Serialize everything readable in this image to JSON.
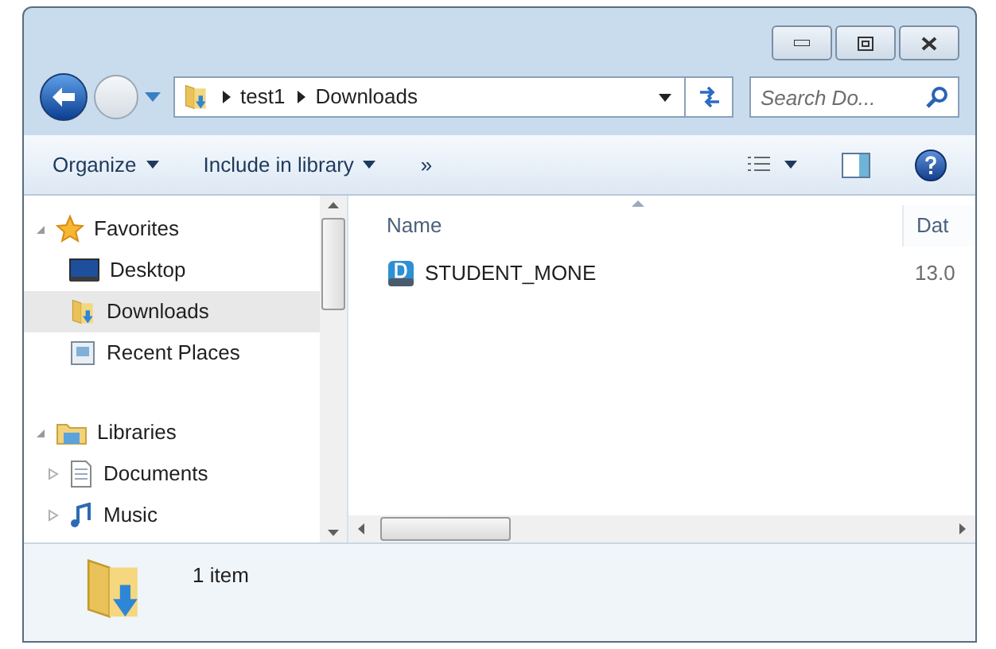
{
  "address": {
    "segments": [
      "test1",
      "Downloads"
    ]
  },
  "search": {
    "placeholder": "Search Do..."
  },
  "toolbar": {
    "buttons": [
      {
        "label": "Organize",
        "kind": "menu"
      },
      {
        "label": "Include in library",
        "kind": "menu"
      },
      {
        "label": "»",
        "kind": "more"
      }
    ]
  },
  "sidebar": {
    "groups": [
      {
        "label": "Favorites",
        "kind": "star",
        "expanded": true,
        "children": [
          {
            "label": "Desktop",
            "kind": "desktop",
            "selected": false
          },
          {
            "label": "Downloads",
            "kind": "downloads",
            "selected": true
          },
          {
            "label": "Recent Places",
            "kind": "recent",
            "selected": false
          }
        ]
      },
      {
        "label": "Libraries",
        "kind": "library",
        "expanded": true,
        "children": [
          {
            "label": "Documents",
            "kind": "document",
            "selected": false,
            "expanded": false
          },
          {
            "label": "Music",
            "kind": "music",
            "selected": false,
            "expanded": false
          }
        ]
      }
    ]
  },
  "table": {
    "columns": [
      "Name",
      "Dat"
    ],
    "rows": [
      {
        "cells": [
          "STUDENT_MONE",
          "13.0"
        ]
      }
    ]
  },
  "status_bar": {
    "text": "1 item"
  }
}
